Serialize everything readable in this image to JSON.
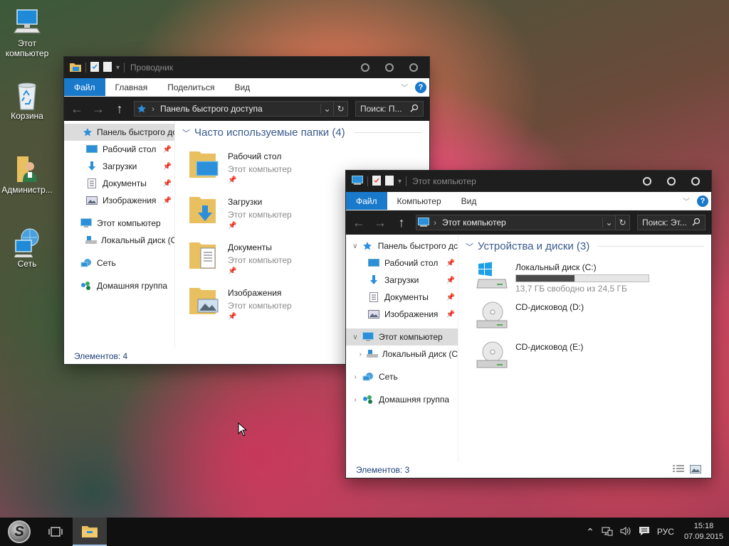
{
  "desktop": {
    "icons": [
      {
        "label_1": "Этот",
        "label_2": "компьютер",
        "icon": "computer-icon"
      },
      {
        "label_1": "Корзина",
        "label_2": "",
        "icon": "recycle-bin-icon"
      },
      {
        "label_1": "Администр...",
        "label_2": "",
        "icon": "user-folder-icon"
      },
      {
        "label_1": "Сеть",
        "label_2": "",
        "icon": "network-icon"
      }
    ]
  },
  "win1": {
    "title": "Проводник",
    "ribbon": {
      "file": "Файл",
      "tabs": [
        "Главная",
        "Поделиться",
        "Вид"
      ]
    },
    "address": "Панель быстрого доступа",
    "search": "Поиск: П...",
    "nav": [
      {
        "label": "Панель быстрого доступа"
      },
      {
        "label": "Рабочий стол"
      },
      {
        "label": "Загрузки"
      },
      {
        "label": "Документы"
      },
      {
        "label": "Изображения"
      },
      {
        "label": "Этот компьютер"
      },
      {
        "label": "Локальный диск (C"
      },
      {
        "label": "Сеть"
      },
      {
        "label": "Домашняя группа"
      }
    ],
    "group_title": "Часто используемые папки (4)",
    "folders": [
      {
        "name": "Рабочий стол",
        "location": "Этот компьютер"
      },
      {
        "name": "Загрузки",
        "location": "Этот компьютер"
      },
      {
        "name": "Документы",
        "location": "Этот компьютер"
      },
      {
        "name": "Изображения",
        "location": "Этот компьютер"
      }
    ],
    "status": "Элементов: 4"
  },
  "win2": {
    "title": "Этот компьютер",
    "ribbon": {
      "file": "Файл",
      "tabs": [
        "Компьютер",
        "Вид"
      ]
    },
    "address": "Этот компьютер",
    "search": "Поиск: Эт...",
    "nav": [
      {
        "label": "Панель быстрого дс"
      },
      {
        "label": "Рабочий стол"
      },
      {
        "label": "Загрузки"
      },
      {
        "label": "Документы"
      },
      {
        "label": "Изображения"
      },
      {
        "label": "Этот компьютер"
      },
      {
        "label": "Локальный диск (C"
      },
      {
        "label": "Сеть"
      },
      {
        "label": "Домашняя группа"
      }
    ],
    "group_title": "Устройства и диски (3)",
    "drives": [
      {
        "name": "Локальный диск (C:)",
        "free_text": "13,7 ГБ свободно из 24,5 ГБ",
        "used_fraction": 0.44
      },
      {
        "name": "CD-дисковод (D:)"
      },
      {
        "name": "CD-дисковод (E:)"
      }
    ],
    "status": "Элементов: 3"
  },
  "taskbar": {
    "language": "РУС",
    "time": "15:18",
    "date": "07.09.2015"
  },
  "colors": {
    "accent": "#1979ca",
    "titlebar": "#1e1e1e",
    "taskbar": "#101010"
  }
}
